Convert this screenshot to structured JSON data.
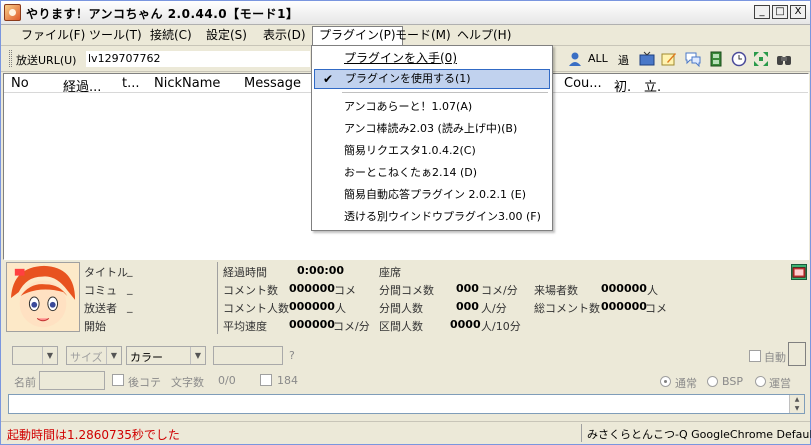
{
  "window": {
    "title": "やります！アンコちゃん 2.0.44.0【モード1】",
    "buttons": {
      "minimize": "_",
      "maximize": "□",
      "close": "X"
    }
  },
  "menubar": {
    "items": [
      {
        "label": "ファイル(F)"
      },
      {
        "label": "ツール(T)"
      },
      {
        "label": "接続(C)"
      },
      {
        "label": "設定(S)"
      },
      {
        "label": "表示(D)"
      },
      {
        "label": "プラグイン(P)"
      },
      {
        "label": "モード(M)"
      },
      {
        "label": "ヘルプ(H)"
      }
    ]
  },
  "toolbar": {
    "url_label": "放送URL(U)",
    "url_value": "lv129707762",
    "all_label": "ALL",
    "past_label": "過"
  },
  "listview": {
    "columns": [
      "No",
      "経過...",
      "t...",
      "NickName",
      "Message",
      "Cou...",
      "初.",
      "立."
    ]
  },
  "plugin_menu": {
    "items": [
      {
        "label": "プラグインを入手(0)"
      },
      {
        "label": "プラグインを使用する(1)",
        "check": "✔"
      },
      {
        "label": "アンコあらーと！1.07(A)"
      },
      {
        "label": "アンコ棒読み2.03 (読み上げ中)(B)"
      },
      {
        "label": "簡易リクエスタ1.0.4.2(C)"
      },
      {
        "label": "おーとこねくたぁ2.14 (D)"
      },
      {
        "label": "簡易自動応答プラグイン 2.0.2.1 (E)"
      },
      {
        "label": "透ける別ウインドウプラグイン3.00 (F)"
      }
    ]
  },
  "info": {
    "left": {
      "title_label": "タイトル",
      "title_value": "_",
      "community_label": "コミュ",
      "community_value": "_",
      "broadcaster_label": "放送者",
      "broadcaster_value": "_",
      "start_label": "開始"
    },
    "stats": {
      "elapsed_label": "経過時間",
      "elapsed_value": "0:00:00",
      "seats_label": "座席",
      "comments_label": "コメント数",
      "comments_value": "000000",
      "comments_unit": "コメ",
      "commenters_label": "コメント人数",
      "commenters_value": "000000",
      "commenters_unit": "人",
      "avg_speed_label": "平均速度",
      "avg_speed_value": "000000",
      "avg_speed_unit": "コメ/分",
      "per_min_comments_label": "分間コメ数",
      "per_min_comments_value": "000",
      "per_min_comments_unit": "コメ/分",
      "per_min_people_label": "分間人数",
      "per_min_people_value": "000",
      "per_min_people_unit": "人/分",
      "interval_people_label": "区間人数",
      "interval_people_value": "0000",
      "interval_people_unit": "人/10分",
      "visitors_label": "来場者数",
      "visitors_value": "000000",
      "visitors_unit": "人",
      "total_comments_label": "総コメント数",
      "total_comments_value": "000000",
      "total_comments_unit": "コメ"
    }
  },
  "comment_form": {
    "size_placeholder": "サイズ",
    "color_value": "カラー",
    "question": "?",
    "auto_label": "自動",
    "name_label": "名前",
    "after_kote_label": "後コテ",
    "char_count_label": "文字数",
    "char_count_value": "0/0",
    "limit_value": "184",
    "radio_normal": "通常",
    "radio_bsp": "BSP",
    "radio_admin": "運営"
  },
  "statusbar": {
    "left": "起動時間は1.2860735秒でした",
    "right": "みさくらとんこつ-Q GoogleChrome Default"
  },
  "colors": {
    "status_text": "#d00000",
    "menu_highlight": "#c1d2ee",
    "menu_highlight_border": "#316ac5"
  }
}
